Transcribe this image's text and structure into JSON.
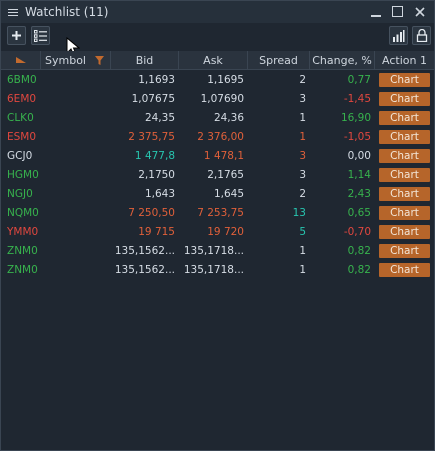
{
  "window": {
    "title": "Watchlist (11)"
  },
  "colors": {
    "up": "#37b24d",
    "down": "#e0473f",
    "neutral": "#d6dde5",
    "bid_up": "#27c6b0",
    "bid_down": "#e0603a",
    "chart_button": "#b6652a"
  },
  "toolbar": {
    "add_icon": "plus-icon",
    "list_icon": "list-icon",
    "signal_icon": "signal-bars-icon",
    "lock_icon": "lock-icon"
  },
  "columns": [
    "Symbol",
    "Bid",
    "Ask",
    "Spread",
    "Change, %",
    "Action 1"
  ],
  "rows": [
    {
      "symbol": "6BM0",
      "bid": "1,1693",
      "ask": "1,1695",
      "spread": "2",
      "change": "0,77",
      "action": "Chart"
    },
    {
      "symbol": "6EM0",
      "bid": "1,07675",
      "ask": "1,07690",
      "spread": "3",
      "change": "-1,45",
      "action": "Chart"
    },
    {
      "symbol": "CLK0",
      "bid": "24,35",
      "ask": "24,36",
      "spread": "1",
      "change": "16,90",
      "action": "Chart"
    },
    {
      "symbol": "ESM0",
      "bid": "2 375,75",
      "ask": "2 376,00",
      "spread": "1",
      "change": "-1,05",
      "action": "Chart"
    },
    {
      "symbol": "GCJ0",
      "bid": "1 477,8",
      "ask": "1 478,1",
      "spread": "3",
      "change": "0,00",
      "action": "Chart"
    },
    {
      "symbol": "HGM0",
      "bid": "2,1750",
      "ask": "2,1765",
      "spread": "3",
      "change": "1,14",
      "action": "Chart"
    },
    {
      "symbol": "NGJ0",
      "bid": "1,643",
      "ask": "1,645",
      "spread": "2",
      "change": "2,43",
      "action": "Chart"
    },
    {
      "symbol": "NQM0",
      "bid": "7 250,50",
      "ask": "7 253,75",
      "spread": "13",
      "change": "0,65",
      "action": "Chart"
    },
    {
      "symbol": "YMM0",
      "bid": "19 715",
      "ask": "19 720",
      "spread": "5",
      "change": "-0,70",
      "action": "Chart"
    },
    {
      "symbol": "ZNM0",
      "bid": "135,1562...",
      "ask": "135,1718...",
      "spread": "1",
      "change": "0,82",
      "action": "Chart"
    },
    {
      "symbol": "ZNM0",
      "bid": "135,1562...",
      "ask": "135,1718...",
      "spread": "1",
      "change": "0,82",
      "action": "Chart"
    }
  ]
}
